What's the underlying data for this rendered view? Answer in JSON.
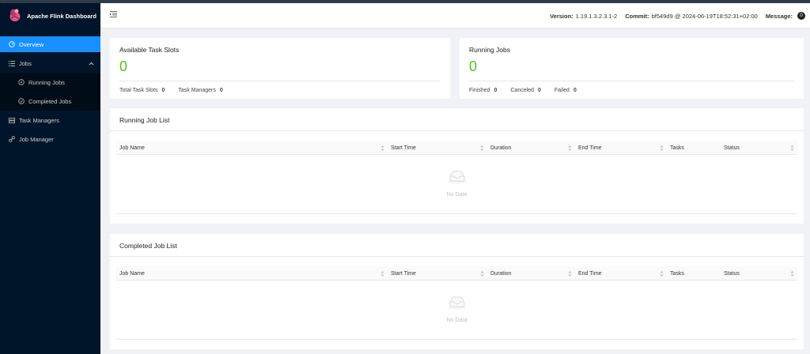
{
  "app": {
    "title": "Apache Flink Dashboard"
  },
  "sidebar": {
    "items": [
      {
        "label": "Overview",
        "icon": "dashboard-icon"
      },
      {
        "label": "Jobs",
        "icon": "list-icon"
      },
      {
        "label": "Running Jobs",
        "icon": "play-circle-icon"
      },
      {
        "label": "Completed Jobs",
        "icon": "check-circle-icon"
      },
      {
        "label": "Task Managers",
        "icon": "server-icon"
      },
      {
        "label": "Job Manager",
        "icon": "cluster-icon"
      }
    ]
  },
  "header": {
    "version_label": "Version:",
    "version_value": "1.19.1.3.2.3.1-2",
    "commit_label": "Commit:",
    "commit_value": "bf549d9 @ 2024-06-19T18:52:31+02:00",
    "message_label": "Message:",
    "message_count": "0"
  },
  "slots_card": {
    "title": "Available Task Slots",
    "value": "0",
    "stats": [
      {
        "label": "Total Task Slots",
        "value": "0"
      },
      {
        "label": "Task Managers",
        "value": "0"
      }
    ]
  },
  "jobs_card": {
    "title": "Running Jobs",
    "value": "0",
    "stats": [
      {
        "label": "Finished",
        "value": "0"
      },
      {
        "label": "Canceled",
        "value": "0"
      },
      {
        "label": "Failed",
        "value": "0"
      }
    ]
  },
  "running_list": {
    "title": "Running Job List",
    "columns": [
      "Job Name",
      "Start Time",
      "Duration",
      "End Time",
      "Tasks",
      "Status"
    ],
    "empty_text": "No Data"
  },
  "completed_list": {
    "title": "Completed Job List",
    "columns": [
      "Job Name",
      "Start Time",
      "Duration",
      "End Time",
      "Tasks",
      "Status"
    ],
    "empty_text": "No Data"
  },
  "colors": {
    "sidebar_bg": "#001529",
    "active_item": "#1890ff",
    "metric_green": "#52c41a"
  }
}
